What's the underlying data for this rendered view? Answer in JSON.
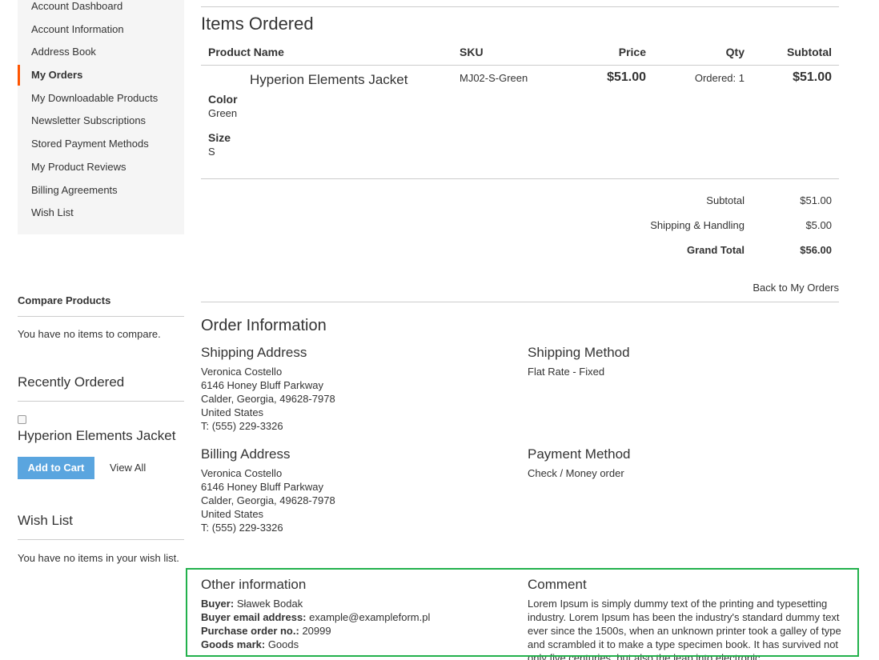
{
  "sidebar": {
    "items": [
      {
        "label": "Account Dashboard",
        "active": false
      },
      {
        "label": "Account Information",
        "active": false
      },
      {
        "label": "Address Book",
        "active": false
      },
      {
        "label": "My Orders",
        "active": true
      },
      {
        "label": "My Downloadable Products",
        "active": false
      },
      {
        "label": "Newsletter Subscriptions",
        "active": false
      },
      {
        "label": "Stored Payment Methods",
        "active": false
      },
      {
        "label": "My Product Reviews",
        "active": false
      },
      {
        "label": "Billing Agreements",
        "active": false
      },
      {
        "label": "Wish List",
        "active": false
      }
    ],
    "accent": "#ff5501",
    "compare": {
      "title": "Compare Products",
      "empty": "You have no items to compare."
    },
    "recent": {
      "title": "Recently Ordered",
      "product": "Hyperion Elements Jacket",
      "add_to_cart": "Add to Cart",
      "view_all": "View All"
    },
    "wishlist": {
      "title": "Wish List",
      "empty": "You have no items in your wish list."
    }
  },
  "items": {
    "title": "Items Ordered",
    "headers": {
      "name": "Product Name",
      "sku": "SKU",
      "price": "Price",
      "qty": "Qty",
      "subtotal": "Subtotal"
    },
    "row": {
      "name": "Hyperion Elements Jacket",
      "sku": "MJ02-S-Green",
      "price": "$51.00",
      "qty": "Ordered: 1",
      "subtotal": "$51.00",
      "options": [
        {
          "label": "Color",
          "value": "Green"
        },
        {
          "label": "Size",
          "value": "S"
        }
      ]
    },
    "totals": [
      {
        "label": "Subtotal",
        "value": "$51.00"
      },
      {
        "label": "Shipping & Handling",
        "value": "$5.00"
      },
      {
        "label": "Grand Total",
        "value": "$56.00"
      }
    ],
    "back": "Back to My Orders"
  },
  "order_info": {
    "title": "Order Information",
    "shipping_address": {
      "title": "Shipping Address",
      "lines": [
        "Veronica Costello",
        "6146 Honey Bluff Parkway",
        "Calder, Georgia, 49628-7978",
        "United States",
        "T: (555) 229-3326"
      ]
    },
    "shipping_method": {
      "title": "Shipping Method",
      "value": "Flat Rate - Fixed"
    },
    "billing_address": {
      "title": "Billing Address",
      "lines": [
        "Veronica Costello",
        "6146 Honey Bluff Parkway",
        "Calder, Georgia, 49628-7978",
        "United States",
        "T: (555) 229-3326"
      ]
    },
    "payment_method": {
      "title": "Payment Method",
      "value": "Check / Money order"
    }
  },
  "other": {
    "title": "Other information",
    "fields": [
      {
        "label": "Buyer:",
        "value": "Sławek Bodak"
      },
      {
        "label": "Buyer email address:",
        "value": "example@exampleform.pl"
      },
      {
        "label": "Purchase order no.:",
        "value": "20999"
      },
      {
        "label": "Goods mark:",
        "value": "Goods"
      }
    ],
    "comment_title": "Comment",
    "comment": "Lorem Ipsum is simply dummy text of the printing and typesetting industry. Lorem Ipsum has been the industry's standard dummy text ever since the 1500s, when an unknown printer took a galley of type and scrambled it to make a type specimen book. It has survived not only five centuries, but also the leap into electronic",
    "highlight": "#22b14c"
  }
}
